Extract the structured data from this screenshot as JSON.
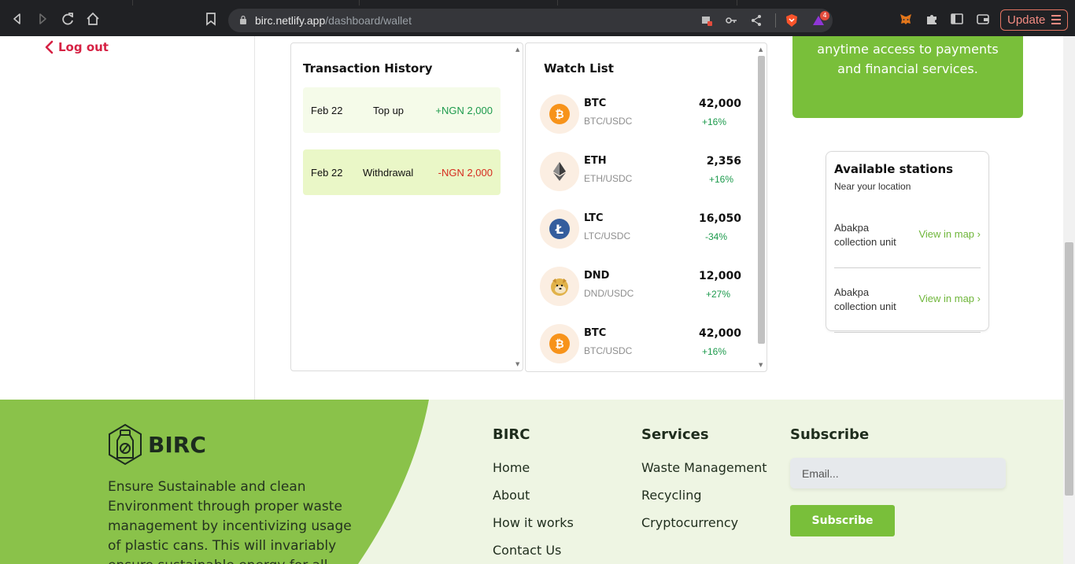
{
  "browser": {
    "url_host": "birc.netlify.app",
    "url_path": "/dashboard/wallet",
    "update_label": "Update",
    "notification_count": "4"
  },
  "sidebar": {
    "logout_label": "Log out"
  },
  "transaction_history": {
    "title": "Transaction History",
    "rows": [
      {
        "date": "Feb 22",
        "type": "Top up",
        "amount": "+NGN 2,000",
        "amount_color": "#1c9a4c",
        "bg": "#f5fbe9"
      },
      {
        "date": "Feb 22",
        "type": "Withdrawal",
        "amount": "-NGN 2,000",
        "amount_color": "#d62b1f",
        "bg": "#eaf7c7"
      }
    ]
  },
  "watch_list": {
    "title": "Watch List",
    "coins": [
      {
        "icon": "bitcoin-icon",
        "symbol": "BTC",
        "pair": "BTC/USDC",
        "price": "42,000",
        "change": "+16%",
        "change_color": "#1c9a4c"
      },
      {
        "icon": "ethereum-icon",
        "symbol": "ETH",
        "pair": "ETH/USDC",
        "price": "2,356",
        "change": "+16%",
        "change_color": "#1c9a4c"
      },
      {
        "icon": "litecoin-icon",
        "symbol": "LTC",
        "pair": "LTC/USDC",
        "price": "16,050",
        "change": "-34%",
        "change_color": "#1c9a4c"
      },
      {
        "icon": "doge-icon",
        "symbol": "DND",
        "pair": "DND/USDC",
        "price": "12,000",
        "change": "+27%",
        "change_color": "#1c9a4c"
      },
      {
        "icon": "bitcoin-icon",
        "symbol": "BTC",
        "pair": "BTC/USDC",
        "price": "42,000",
        "change": "+16%",
        "change_color": "#1c9a4c"
      }
    ]
  },
  "promo": {
    "line1": "anytime access to payments",
    "line2": "and financial services."
  },
  "stations": {
    "title": "Available stations",
    "subtitle": "Near your location",
    "items": [
      {
        "name": "Abakpa collection unit",
        "link": "View in map"
      },
      {
        "name": "Abakpa collection unit",
        "link": "View in map"
      }
    ]
  },
  "footer": {
    "brand": "BIRC",
    "description": "Ensure Sustainable and clean Environment through proper waste management by incentivizing usage of plastic cans. This will invariably ensure sustainable energy for all.",
    "columns": {
      "birc": {
        "title": "BIRC",
        "links": [
          "Home",
          "About",
          "How it works",
          "Contact Us"
        ]
      },
      "services": {
        "title": "Services",
        "links": [
          "Waste Management",
          "Recycling",
          "Cryptocurrency"
        ]
      },
      "subscribe": {
        "title": "Subscribe",
        "placeholder": "Email...",
        "button": "Subscribe"
      }
    }
  },
  "colors": {
    "brand_green": "#79bf3a",
    "accent_red": "#d62244",
    "link_green": "#6fb63a"
  }
}
